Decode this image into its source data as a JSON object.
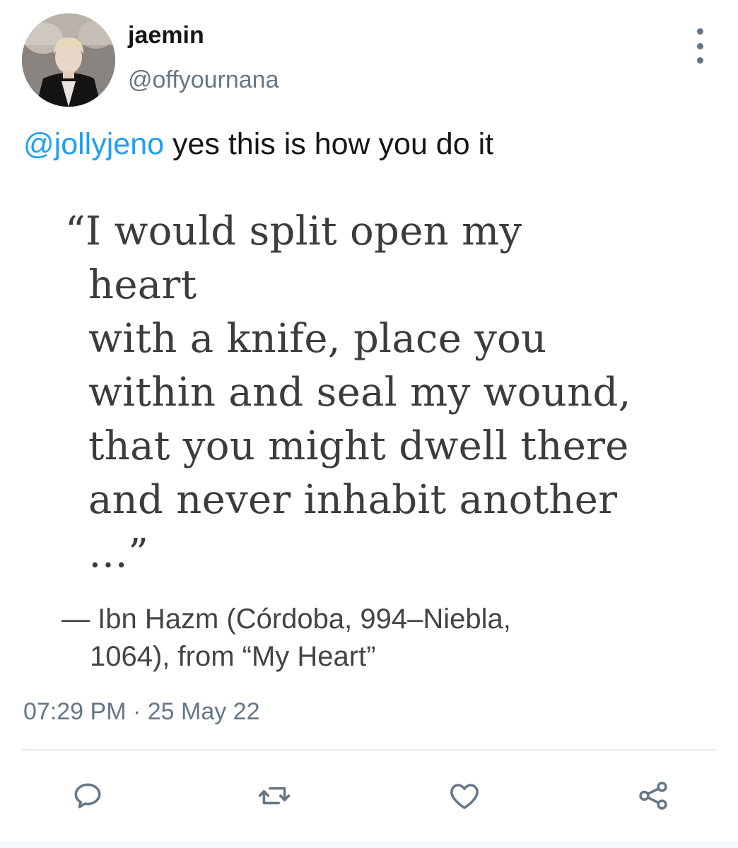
{
  "author": {
    "display_name": "jaemin",
    "handle": "@offyournana",
    "avatar_icon": "profile-photo"
  },
  "tweet": {
    "mention": "@jollyjeno",
    "text": " yes this is how you do it"
  },
  "quote": {
    "lines": [
      "“I would split open my",
      "heart",
      "with a knife, place you",
      "within and seal my wound,",
      "that you might dwell there",
      "and never inhabit another",
      "…”"
    ],
    "attribution_lines": [
      "— Ibn Hazm (Córdoba, 994–Niebla,",
      "1064),  from “My Heart”"
    ]
  },
  "meta": {
    "timestamp": "07:29 PM · 25 May 22"
  },
  "actions": [
    {
      "name": "reply",
      "icon": "reply-icon"
    },
    {
      "name": "retweet",
      "icon": "retweet-icon"
    },
    {
      "name": "like",
      "icon": "heart-icon"
    },
    {
      "name": "share",
      "icon": "share-icon"
    }
  ],
  "colors": {
    "link": "#1da1f2",
    "secondary_text": "#657786",
    "divider": "#e1e8ed",
    "quote_text": "#3c3c3c"
  }
}
